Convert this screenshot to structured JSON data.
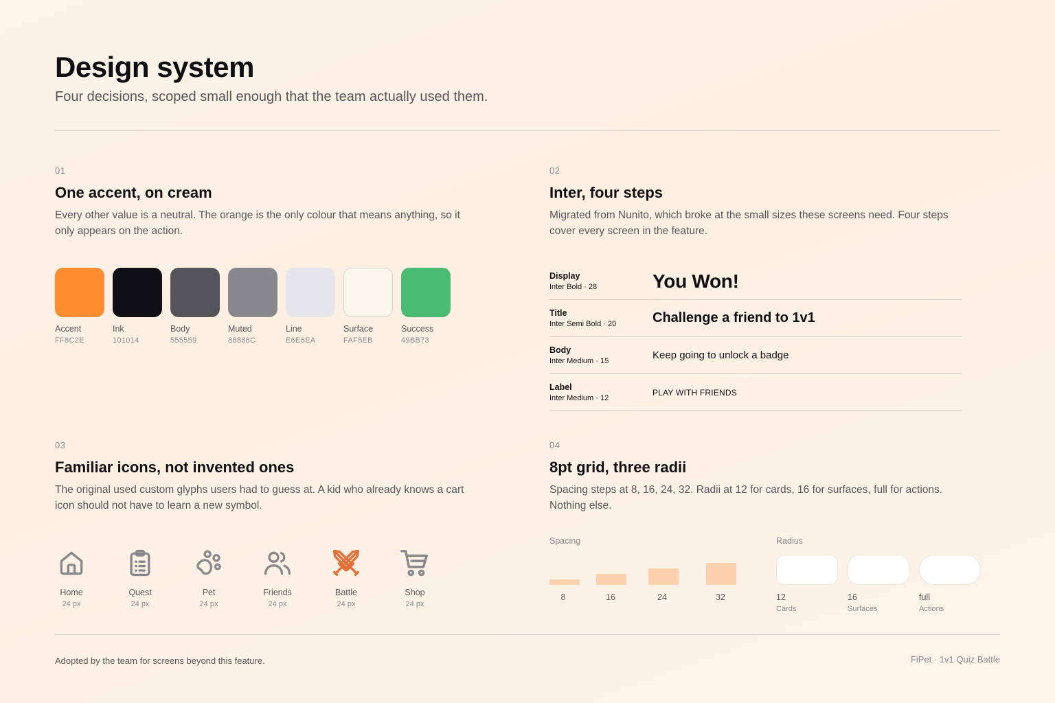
{
  "header": {
    "title": "Design system",
    "subtitle": "Four decisions, scoped small enough that the team actually used them."
  },
  "sections": [
    {
      "number": "01",
      "title": "One accent, on cream",
      "body": "Every other value is a neutral. The orange is the only colour that means anything, so it only appears on the action."
    },
    {
      "number": "02",
      "title": "Inter, four steps",
      "body": "Migrated from Nunito, which broke at the small sizes these screens need. Four steps cover every screen in the feature."
    },
    {
      "number": "03",
      "title": "Familiar icons, not invented ones",
      "body": "The original used custom glyphs users had to guess at. A kid who already knows a cart icon should not have to learn a new symbol."
    },
    {
      "number": "04",
      "title": "8pt grid, three radii",
      "body": "Spacing steps at 8, 16, 24, 32. Radii at 12 for cards, 16 for surfaces, full for actions. Nothing else."
    }
  ],
  "colors": [
    {
      "name": "Accent",
      "hex": "FF8C2E",
      "color": "#FF8C2E"
    },
    {
      "name": "Ink",
      "hex": "101014",
      "color": "#101014"
    },
    {
      "name": "Body",
      "hex": "555559",
      "color": "#555559"
    },
    {
      "name": "Muted",
      "hex": "88888C",
      "color": "#88888C"
    },
    {
      "name": "Line",
      "hex": "E6E6EA",
      "color": "#E6E6EA"
    },
    {
      "name": "Surface",
      "hex": "FAF5EB",
      "color": "#FAF5EB"
    },
    {
      "name": "Success",
      "hex": "49BB73",
      "color": "#49BB73"
    }
  ],
  "typescale": [
    {
      "name": "Display",
      "spec": "Inter Bold · 28",
      "sample": "You Won!"
    },
    {
      "name": "Title",
      "spec": "Inter Semi Bold · 20",
      "sample": "Challenge a friend to 1v1"
    },
    {
      "name": "Body",
      "spec": "Inter Medium · 15",
      "sample": "Keep going to unlock a badge"
    },
    {
      "name": "Label",
      "spec": "Inter Medium · 12",
      "sample": "PLAY WITH FRIENDS"
    }
  ],
  "icons": [
    {
      "name": "Home",
      "size": "24 px",
      "icon": "home-icon",
      "color": "#88888C"
    },
    {
      "name": "Quest",
      "size": "24 px",
      "icon": "clipboard-icon",
      "color": "#88888C"
    },
    {
      "name": "Pet",
      "size": "24 px",
      "icon": "paw-icon",
      "color": "#88888C"
    },
    {
      "name": "Friends",
      "size": "24 px",
      "icon": "users-icon",
      "color": "#88888C"
    },
    {
      "name": "Battle",
      "size": "24 px",
      "icon": "crossed-swords-icon",
      "color": "#E2703A"
    },
    {
      "name": "Shop",
      "size": "24 px",
      "icon": "cart-icon",
      "color": "#88888C"
    }
  ],
  "spacing": {
    "label": "Spacing",
    "steps": [
      "8",
      "16",
      "24",
      "32"
    ],
    "bar_color": "#FDD1AD"
  },
  "radius": {
    "label": "Radius",
    "items": [
      {
        "value": "12",
        "use": "Cards"
      },
      {
        "value": "16",
        "use": "Surfaces"
      },
      {
        "value": "full",
        "use": "Actions"
      }
    ]
  },
  "footer": {
    "left": "Adopted by the team for screens beyond this feature.",
    "right": "FiPet · 1v1 Quiz Battle"
  }
}
